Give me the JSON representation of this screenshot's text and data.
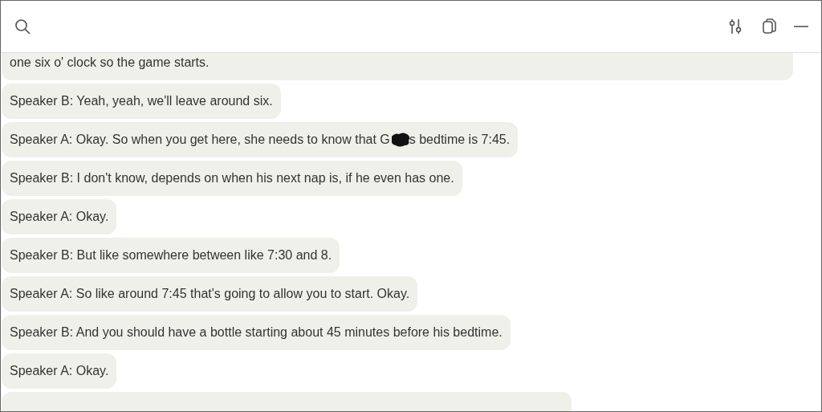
{
  "toolbar": {
    "buttons": [
      {
        "kind": "search"
      },
      {
        "kind": "filters"
      },
      {
        "kind": "copy"
      },
      {
        "kind": "minimize"
      }
    ]
  },
  "messages": [
    {
      "kind": "message",
      "text": "one six o' clock so the game starts."
    },
    {
      "kind": "message",
      "text": "Speaker B: Yeah, yeah, we'll leave around six."
    },
    {
      "kind": "redacted",
      "text": "Speaker A: Okay. So when you get here, she needs to know that G",
      "text_after": "s bedtime is 7:45."
    },
    {
      "kind": "message",
      "text": "Speaker B: I don't know, depends on when his next nap is, if he even has one."
    },
    {
      "kind": "message",
      "text": "Speaker A: Okay."
    },
    {
      "kind": "message",
      "text": "Speaker B: But like somewhere between like 7:30 and 8."
    },
    {
      "kind": "message",
      "text": "Speaker A: So like around 7:45 that's going to allow you to start. Okay."
    },
    {
      "kind": "message",
      "text": "Speaker B: And you should have a bottle starting about 45 minutes before his bedtime."
    },
    {
      "kind": "message",
      "text": "Speaker A: Okay."
    },
    {
      "kind": "cut-off"
    }
  ]
}
